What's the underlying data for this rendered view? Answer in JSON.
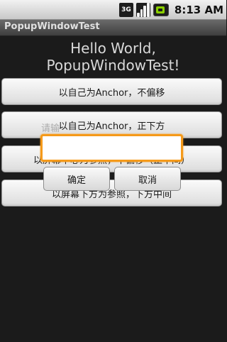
{
  "status_bar": {
    "network_label": "3G",
    "time": "8:13 AM",
    "icons": [
      "network-3g-icon",
      "signal-icon",
      "battery-icon"
    ]
  },
  "app": {
    "title": "PopupWindowTest"
  },
  "main": {
    "hello_line1": "Hello World,",
    "hello_line2": "PopupWindowTest!",
    "buttons": [
      {
        "label": "以自己为Anchor，不偏移"
      },
      {
        "label": "以自己为Anchor，正下方"
      },
      {
        "label": "以屏幕中心为参照，不偏移（正中间）"
      },
      {
        "label": "以屏幕下方为参照，下方中间"
      }
    ],
    "ghost_texts": [
      "请输"
    ]
  },
  "popup": {
    "input_value": "",
    "ok_label": "确定",
    "cancel_label": "取消"
  },
  "colors": {
    "background": "#1b1b1b",
    "focus_border": "#f59a1a",
    "battery": "#8bd000"
  }
}
